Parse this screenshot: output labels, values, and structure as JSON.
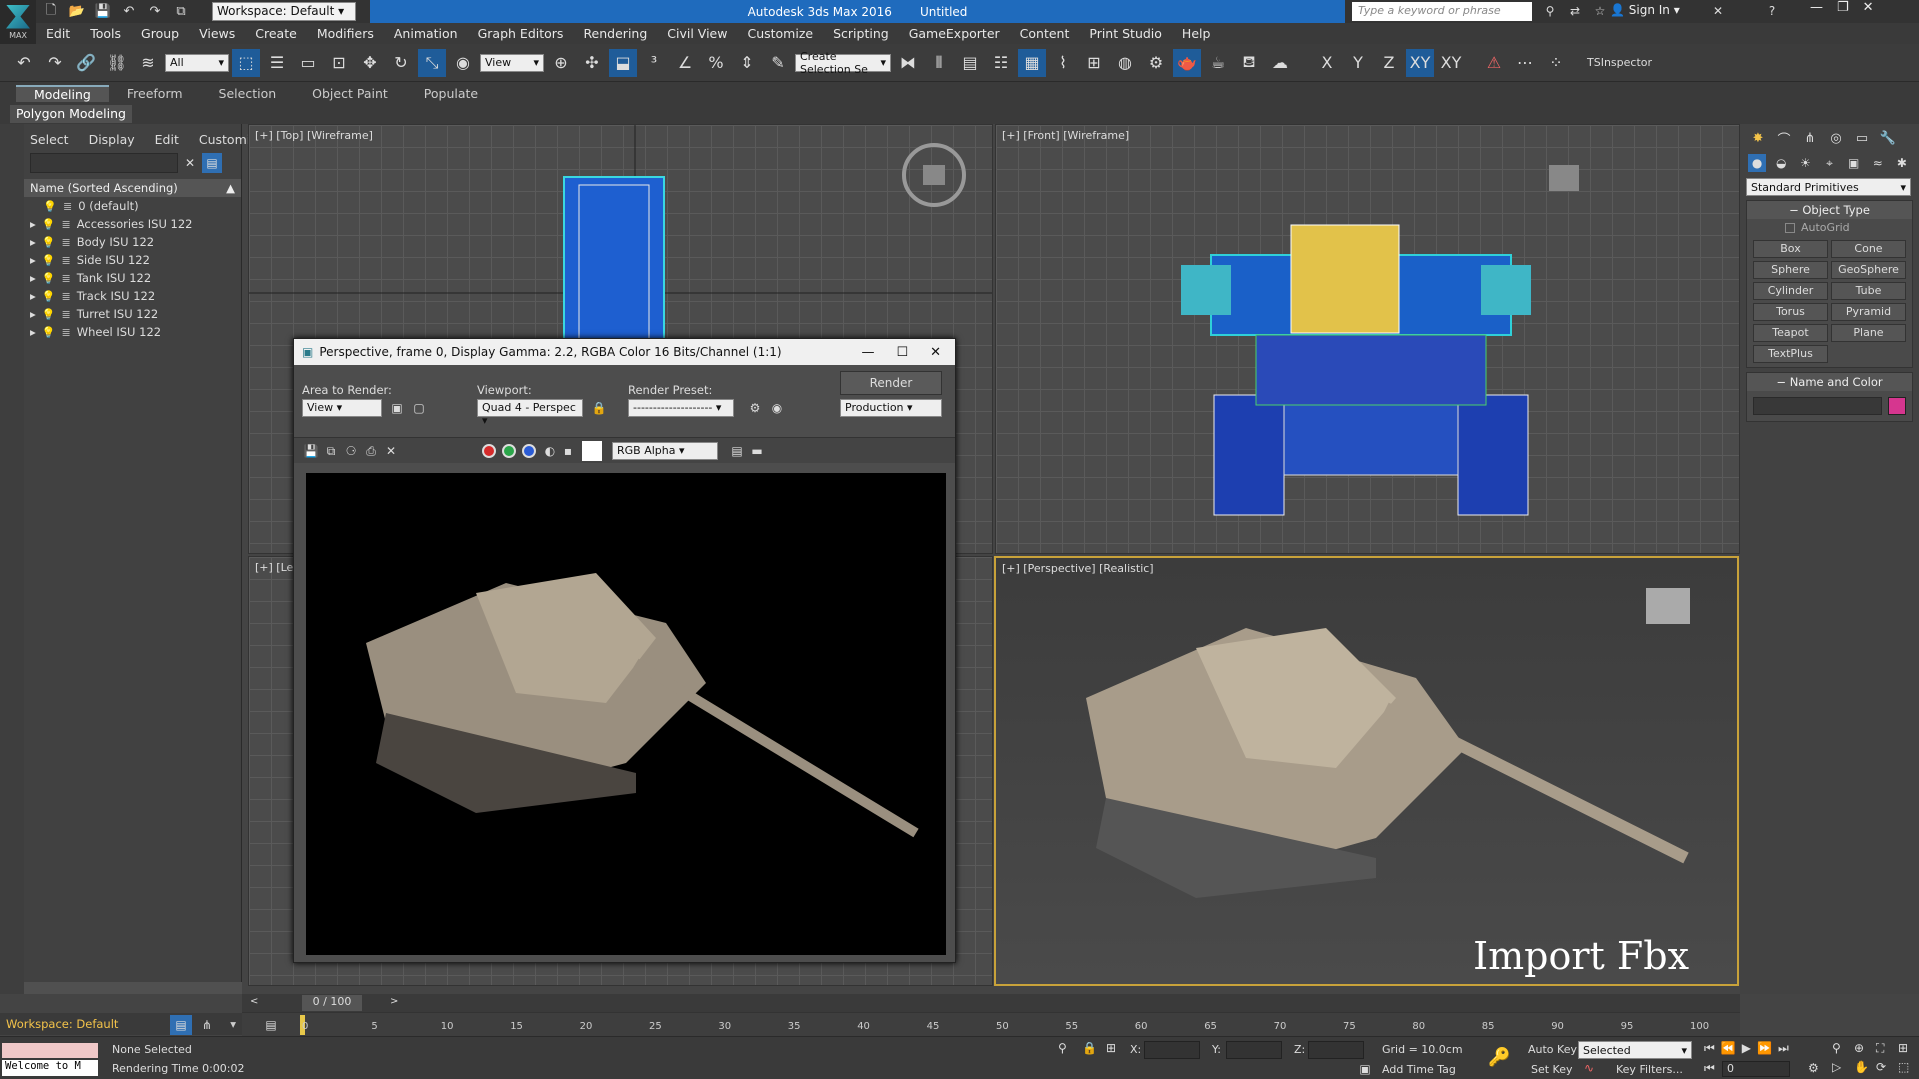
{
  "app": {
    "title": "Autodesk 3ds Max 2016",
    "file": "Untitled",
    "workspace": "Workspace: Default",
    "search_placeholder": "Type a keyword or phrase",
    "sign_in": "Sign In",
    "logo_text": "MAX"
  },
  "menu": [
    "Edit",
    "Tools",
    "Group",
    "Views",
    "Create",
    "Modifiers",
    "Animation",
    "Graph Editors",
    "Rendering",
    "Civil View",
    "Customize",
    "Scripting",
    "GameExporter",
    "Content",
    "Print Studio",
    "Help"
  ],
  "toolbar": {
    "selection_filter": "All",
    "ref_coord": "View",
    "named_selection_placeholder": "Create Selection Se",
    "axis_x": "X",
    "axis_y": "Y",
    "axis_z": "Z",
    "axis_xy": "XY",
    "axis_xy2": "XY",
    "tsinspector": "TSInspector"
  },
  "ribbon": {
    "tabs": [
      "Modeling",
      "Freeform",
      "Selection",
      "Object Paint",
      "Populate"
    ],
    "active_tab": "Modeling",
    "panel": "Polygon Modeling"
  },
  "scene_explorer": {
    "menu": [
      "Select",
      "Display",
      "Edit",
      "Customize"
    ],
    "column_header": "Name (Sorted Ascending)",
    "layers": [
      "0 (default)",
      "Accessories ISU 122",
      "Body ISU 122",
      "Side ISU 122",
      "Tank ISU 122",
      "Track ISU 122",
      "Turret ISU 122",
      "Wheel ISU 122"
    ]
  },
  "viewports": {
    "top": "[+] [Top] [Wireframe]",
    "front": "[+] [Front] [Wireframe]",
    "left": "[+] [Le",
    "perspective": "[+] [Perspective] [Realistic]",
    "overlay_text": "Import Fbx"
  },
  "render_window": {
    "title": "Perspective, frame 0, Display Gamma: 2.2, RGBA Color 16 Bits/Channel (1:1)",
    "area_label": "Area to Render:",
    "area_value": "View",
    "viewport_label": "Viewport:",
    "viewport_value": "Quad 4 - Perspec",
    "preset_label": "Render Preset:",
    "preset_value": "--------------------",
    "render_button": "Render",
    "mode_value": "Production",
    "channel_value": "RGB Alpha"
  },
  "command_panel": {
    "category": "Standard Primitives",
    "object_type_header": "Object Type",
    "autogrid": "AutoGrid",
    "buttons": [
      "Box",
      "Cone",
      "Sphere",
      "GeoSphere",
      "Cylinder",
      "Tube",
      "Torus",
      "Pyramid",
      "Teapot",
      "Plane",
      "TextPlus"
    ],
    "name_color_header": "Name and Color",
    "swatch_color": "#d6368f"
  },
  "timeline": {
    "frame_display": "0 / 100",
    "ticks": [
      "0",
      "5",
      "10",
      "15",
      "20",
      "25",
      "30",
      "35",
      "40",
      "45",
      "50",
      "55",
      "60",
      "65",
      "70",
      "75",
      "80",
      "85",
      "90",
      "95",
      "100"
    ]
  },
  "status": {
    "workspace": "Workspace: Default",
    "maxscript": "Welcome to M",
    "selection": "None Selected",
    "render_time": "Rendering Time  0:00:02",
    "x_label": "X:",
    "y_label": "Y:",
    "z_label": "Z:",
    "grid": "Grid = 10.0cm",
    "add_time_tag": "Add Time Tag",
    "auto_key": "Auto Key",
    "set_key": "Set Key",
    "selected": "Selected",
    "key_filters": "Key Filters...",
    "frame": "0"
  }
}
